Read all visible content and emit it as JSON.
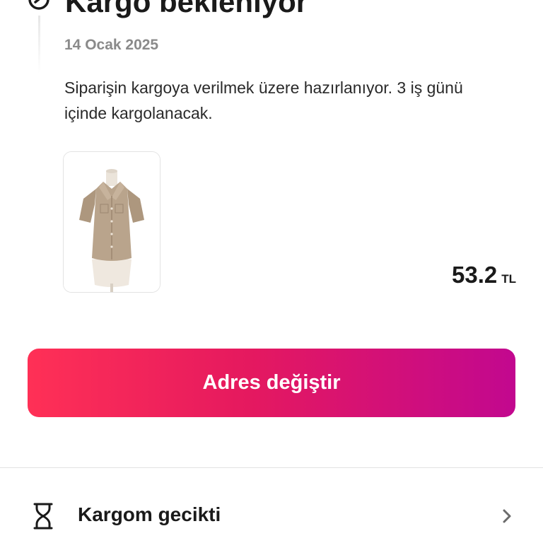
{
  "status": {
    "title": "Kargo bekleniyor",
    "date": "14 Ocak 2025",
    "description": "Siparişin kargoya verilmek üzere hazırlanıyor. 3 iş günü içinde kargolanacak.",
    "icon": "clock-icon"
  },
  "product": {
    "image_icon": "shirt-on-mannequin-image",
    "price": "53.2",
    "currency": "TL"
  },
  "actions": {
    "change_address_label": "Adres değiştir"
  },
  "list": {
    "items": [
      {
        "label": "Kargom gecikti",
        "icon": "hourglass-icon",
        "chevron": "chevron-right-icon"
      }
    ]
  },
  "colors": {
    "button_gradient_start": "#ff3056",
    "button_gradient_end": "#c2088f",
    "muted_text": "#8a8a8a"
  }
}
